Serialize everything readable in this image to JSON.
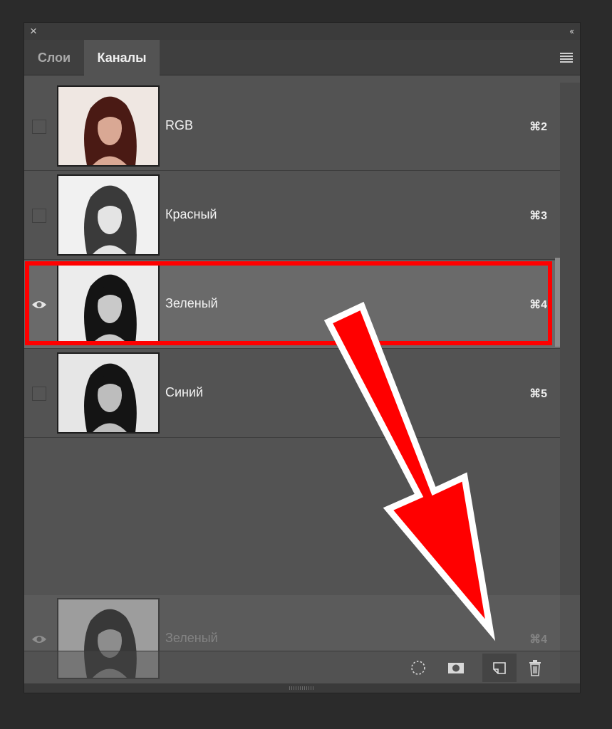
{
  "panel": {
    "close_icon": "×",
    "collapse_icon": "‹‹",
    "tabs": [
      {
        "label": "Слои",
        "active": false
      },
      {
        "label": "Каналы",
        "active": true
      }
    ],
    "menu_icon": "hamburger-menu-icon"
  },
  "channels": [
    {
      "name": "RGB",
      "shortcut": "⌘2",
      "visible": false,
      "selected": false,
      "thumb": "color"
    },
    {
      "name": "Красный",
      "shortcut": "⌘3",
      "visible": false,
      "selected": false,
      "thumb": "light"
    },
    {
      "name": "Зеленый",
      "shortcut": "⌘4",
      "visible": true,
      "selected": true,
      "thumb": "mid"
    },
    {
      "name": "Синий",
      "shortcut": "⌘5",
      "visible": false,
      "selected": false,
      "thumb": "dark"
    }
  ],
  "drag_ghost": {
    "name": "Зеленый",
    "shortcut": "⌘4"
  },
  "bottom_bar": {
    "icons": [
      "load-selection-icon",
      "save-selection-mask-icon",
      "new-channel-icon",
      "trash-icon"
    ],
    "active_icon": "new-channel-icon"
  },
  "annotations": {
    "highlight_color": "#ff0000",
    "arrow_color": "#ff0000",
    "arrow_outline": "#ffffff"
  }
}
